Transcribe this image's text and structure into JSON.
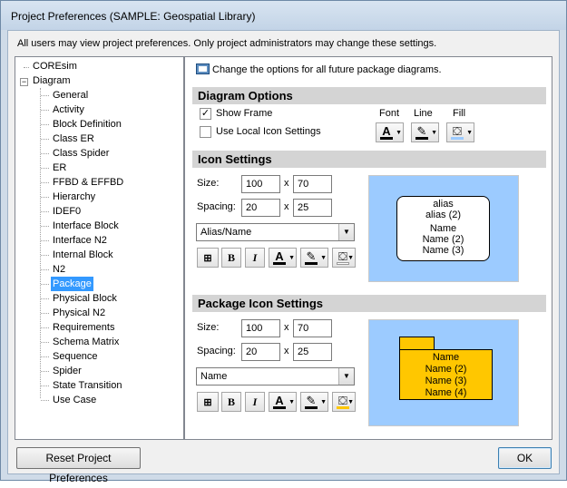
{
  "window": {
    "title": "Project Preferences (SAMPLE: Geospatial Library)"
  },
  "info_text": "All users may view project preferences. Only project administrators may change these settings.",
  "tree": {
    "root_items": [
      {
        "label": "COREsim"
      },
      {
        "label": "Diagram",
        "expander": "−"
      }
    ],
    "diagram_children": [
      "General",
      "Activity",
      "Block Definition",
      "Class ER",
      "Class Spider",
      "ER",
      "FFBD & EFFBD",
      "Hierarchy",
      "IDEF0",
      "Interface Block",
      "Interface N2",
      "Internal Block",
      "N2",
      "Package",
      "Physical Block",
      "Physical N2",
      "Requirements",
      "Schema Matrix",
      "Sequence",
      "Spider",
      "State Transition",
      "Use Case"
    ],
    "selected": "Package"
  },
  "panel": {
    "hint": "Change the options for all future package diagrams.",
    "diagram_options": {
      "title": "Diagram Options",
      "show_frame": {
        "label": "Show Frame",
        "checked": "✓"
      },
      "use_local": {
        "label": "Use Local Icon Settings",
        "checked": ""
      },
      "font_label": "Font",
      "line_label": "Line",
      "fill_label": "Fill"
    },
    "icon_settings": {
      "title": "Icon Settings",
      "size_label": "Size:",
      "size_w": "100",
      "size_h": "70",
      "spacing_label": "Spacing:",
      "spacing_w": "20",
      "spacing_h": "25",
      "x": "x",
      "label_combo": "Alias/Name",
      "bold": "B",
      "italic": "I",
      "preview_lines": [
        "alias",
        "alias (2)",
        "Name",
        "Name (2)",
        "Name (3)"
      ],
      "preview_color": "#9ccbff"
    },
    "package_icon_settings": {
      "title": "Package Icon Settings",
      "size_label": "Size:",
      "size_w": "100",
      "size_h": "70",
      "spacing_label": "Spacing:",
      "spacing_w": "20",
      "spacing_h": "25",
      "x": "x",
      "label_combo": "Name",
      "bold": "B",
      "italic": "I",
      "preview_lines": [
        "Name",
        "Name (2)",
        "Name (3)",
        "Name (4)"
      ],
      "package_color": "#ffc700"
    }
  },
  "buttons": {
    "reset": "Reset Project Preferences",
    "ok": "OK"
  },
  "colors": {
    "selection": "#3399ff",
    "section_header": "#d4d4d4",
    "window_frame": "#cfdbe8"
  }
}
